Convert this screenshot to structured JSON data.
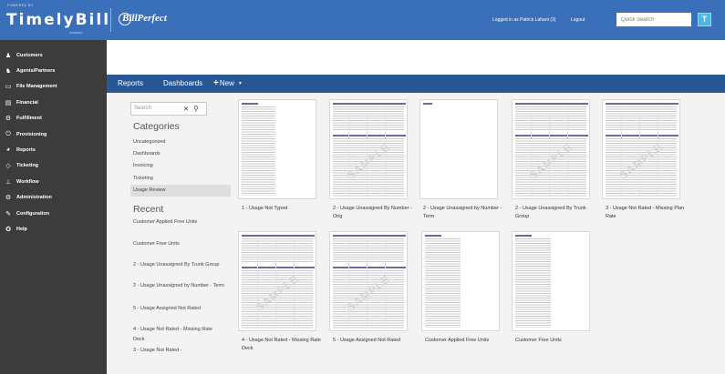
{
  "header": {
    "powered_by": "POWERED BY",
    "brand": "TimelyBill",
    "brand_sub": "CONNECT",
    "partner": "BillPerfect",
    "user_text": "Logged in as Patrick Lahant (3)",
    "logout": "Logout",
    "search_placeholder": "Quick Search",
    "search_button": "T"
  },
  "sidebar": {
    "items": [
      {
        "label": "Customers",
        "icon": "user-icon"
      },
      {
        "label": "Agents/Partners",
        "icon": "users-icon"
      },
      {
        "label": "File Management",
        "icon": "folder-icon"
      },
      {
        "label": "Financial",
        "icon": "ledger-icon"
      },
      {
        "label": "Fulfillment",
        "icon": "gear-icon"
      },
      {
        "label": "Provisioning",
        "icon": "power-icon"
      },
      {
        "label": "Reports",
        "icon": "pie-chart-icon"
      },
      {
        "label": "Ticketing",
        "icon": "tag-icon"
      },
      {
        "label": "Workflow",
        "icon": "sitemap-icon"
      },
      {
        "label": "Administration",
        "icon": "admin-gears-icon"
      },
      {
        "label": "Configuration",
        "icon": "wrench-icon"
      },
      {
        "label": "Help",
        "icon": "lifebuoy-icon"
      }
    ]
  },
  "nav": {
    "reports": "Reports",
    "dashboards": "Dashboards",
    "new": "New"
  },
  "left_panel": {
    "search_placeholder": "Search",
    "categories_heading": "Categories",
    "categories": [
      "Uncategorized",
      "Dashboards",
      "Invoicing",
      "Ticketing",
      "Usage Review"
    ],
    "selected_category": "Usage Review",
    "recent_heading": "Recent",
    "recent": [
      "Customer Applied Free Units",
      "Customer Free Units",
      "2 - Usage Unassigned By Trunk Group",
      "2 - Usage Unassigned by Number - Term",
      "5 - Usage Assigned Not Rated",
      "4 - Usage Not Rated - Missing Rate Deck",
      "3 - Usage Not Rated -"
    ]
  },
  "reports": [
    {
      "title": "1 - Usage Not Typed",
      "watermark": ""
    },
    {
      "title": "2 - Usage Unassigned By Number - Orig",
      "watermark": "SAMPLE"
    },
    {
      "title": "2 - Usage Unassigned by Number - Term",
      "watermark": ""
    },
    {
      "title": "2 - Usage Unassigned By Trunk Group",
      "watermark": "SAMPLE"
    },
    {
      "title": "3 - Usage Not Rated - Missing Plan Rate",
      "watermark": "SAMPLE"
    },
    {
      "title": "4 - Usage Not Rated - Missing Rate Deck",
      "watermark": "SAMPLE"
    },
    {
      "title": "5 - Usage Assigned Not Rated",
      "watermark": "SAMPLE"
    },
    {
      "title": "Customer Applied Free Units",
      "watermark": ""
    },
    {
      "title": "Customer Free Units",
      "watermark": ""
    }
  ],
  "colors": {
    "topbar": "#3a6fb9",
    "navbar": "#285795",
    "sidebar": "#3c3c3c",
    "content_bg": "#f3f3f3",
    "search_button": "#48b8e8",
    "selected_category_bg": "#dedede"
  }
}
